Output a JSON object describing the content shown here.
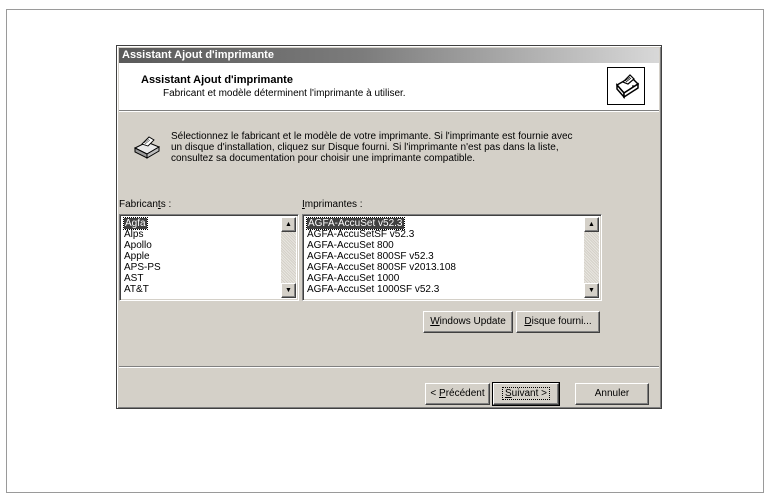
{
  "window": {
    "title": "Assistant Ajout d'imprimante"
  },
  "header": {
    "title": "Assistant Ajout d'imprimante",
    "subtitle": "Fabricant et modèle déterminent l'imprimante à utiliser."
  },
  "instructions": {
    "lines": [
      "Sélectionnez le fabricant et le modèle de votre imprimante. Si l'imprimante est fournie avec",
      "un disque d'installation, cliquez sur Disque fourni. Si l'imprimante n'est pas dans la liste,",
      "consultez sa documentation pour choisir une imprimante compatible."
    ]
  },
  "manufacturers": {
    "label_before": "Fabrican",
    "label_access": "t",
    "label_after": "s :",
    "items": [
      "Agfa",
      "Alps",
      "Apollo",
      "Apple",
      "APS-PS",
      "AST",
      "AT&T"
    ],
    "selected": "Agfa"
  },
  "printers": {
    "label_access": "I",
    "label_after": "mprimantes :",
    "items": [
      "AGFA-AccuSet v52.3",
      "AGFA-AccuSetSF v52.3",
      "AGFA-AccuSet 800",
      "AGFA-AccuSet 800SF v52.3",
      "AGFA-AccuSet 800SF v2013.108",
      "AGFA-AccuSet 1000",
      "AGFA-AccuSet 1000SF v52.3"
    ],
    "selected": "AGFA-AccuSet v52.3"
  },
  "buttons": {
    "windows_update": {
      "access": "W",
      "rest": "indows Update"
    },
    "have_disk": {
      "access": "D",
      "rest": "isque fourni..."
    },
    "back": {
      "before": "< ",
      "access": "P",
      "rest": "récédent"
    },
    "next": {
      "access": "S",
      "rest": "uivant >"
    },
    "cancel": {
      "label": "Annuler"
    }
  }
}
